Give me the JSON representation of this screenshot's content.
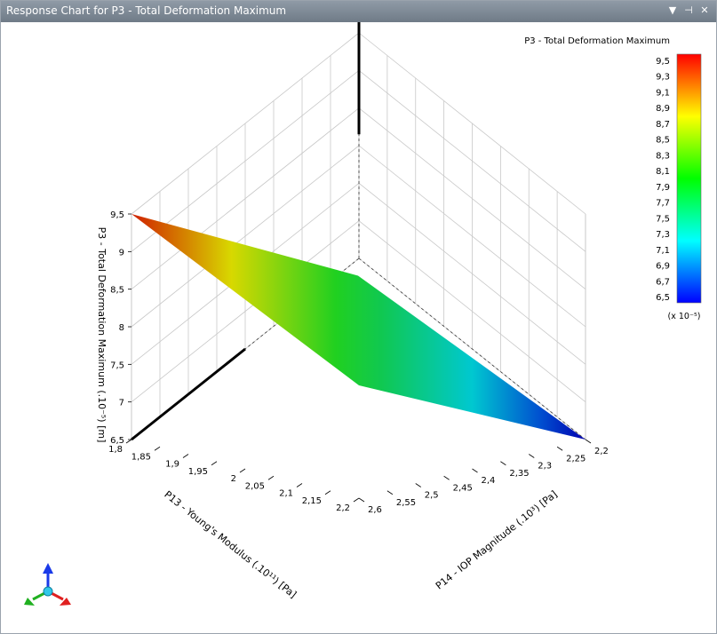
{
  "window": {
    "title": "Response Chart for P3 - Total Deformation Maximum",
    "menu_icon": "dropdown-arrow-icon",
    "pin_icon": "pin-icon",
    "close_icon": "close-icon"
  },
  "chart_data": {
    "type": "surface",
    "title": "P3 - Total Deformation Maximum",
    "colorbar": {
      "title": "P3 - Total Deformation Maximum",
      "ticks": [
        "9,5",
        "9,3",
        "9,1",
        "8,9",
        "8,7",
        "8,5",
        "8,3",
        "8,1",
        "7,9",
        "7,7",
        "7,5",
        "7,3",
        "7,1",
        "6,9",
        "6,7",
        "6,5"
      ],
      "multiplier": "(x 10⁻⁵)",
      "range": [
        6.5,
        9.5
      ],
      "colors": [
        "#ff0000",
        "#ffff00",
        "#00ff00",
        "#00ffff",
        "#0000ff"
      ]
    },
    "x_axis": {
      "label": "P13 - Young's Modulus (.10¹¹) [Pa]",
      "ticks": [
        "1,8",
        "1,85",
        "1,9",
        "1,95",
        "2",
        "2,05",
        "2,1",
        "2,15",
        "2,2"
      ],
      "range": [
        1.8,
        2.2
      ]
    },
    "y_axis": {
      "label": "P14 - IOP Magnitude (.10³) [Pa]",
      "ticks": [
        "2,2",
        "2,25",
        "2,3",
        "2,35",
        "2,4",
        "2,45",
        "2,5",
        "2,55",
        "2,6"
      ],
      "range": [
        2.2,
        2.6
      ]
    },
    "z_axis": {
      "label": "P3 - Total Deformation Maximum (.10⁻⁵) [m]",
      "ticks": [
        "9,5",
        "9",
        "8,5",
        "8",
        "7,5",
        "7",
        "6,5"
      ],
      "range": [
        6.5,
        9.5
      ]
    },
    "surface_corners": [
      {
        "youngs_modulus": 1.8,
        "iop_magnitude": 2.6,
        "deformation": 9.5
      },
      {
        "youngs_modulus": 1.8,
        "iop_magnitude": 2.2,
        "deformation": 7.9
      },
      {
        "youngs_modulus": 2.2,
        "iop_magnitude": 2.6,
        "deformation": 8.0
      },
      {
        "youngs_modulus": 2.2,
        "iop_magnitude": 2.2,
        "deformation": 6.5
      }
    ],
    "triad_icon": "xyz-axis-triad-icon"
  }
}
